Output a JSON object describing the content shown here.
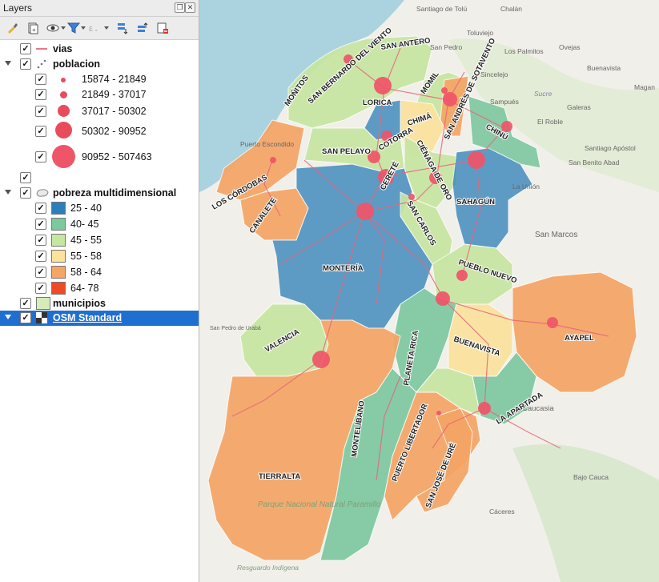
{
  "panel": {
    "title": "Layers"
  },
  "layers": {
    "vias": "vias",
    "poblacion": {
      "name": "poblacion",
      "classes": [
        "15874 - 21849",
        "21849 - 37017",
        "37017 - 50302",
        "50302 - 90952",
        "90952 - 507463"
      ]
    },
    "blank": "",
    "pobreza": {
      "name": "pobreza multidimensional",
      "classes": [
        "25 - 40",
        "40- 45",
        "45 - 55",
        "55 - 58",
        "58 - 64",
        "64- 78"
      ],
      "colors": [
        "#2c7fb8",
        "#7ec8a0",
        "#c7e6a2",
        "#fbe39c",
        "#f5a565",
        "#ef4a26"
      ]
    },
    "municipios": "municipios",
    "osm": "OSM Standard"
  },
  "map": {
    "places": {
      "santiago_tolu": "Santiago de\nTolú",
      "chalan": "Chalán",
      "toluviejo": "Toluviejo",
      "los_palmitos": "Los Palmitos",
      "san_pedro": "San Pedro",
      "ovejas": "Ovejas",
      "buenavista_top": "Buenavista",
      "magangue": "Magan",
      "sincelejo": "Sincelejo",
      "sucre": "Sucre",
      "sampues": "Sampués",
      "galeras": "Galeras",
      "el_roble": "El Roble",
      "puerto_escondido": "Puerto Escondido",
      "moñitos_pt": "Moñitos",
      "san_bernardo_pt": "San Bernardo",
      "santiago_apostol": "Santiago Apóstol",
      "san_benito": "San Benito\nAbad",
      "la_union": "La Unión",
      "san_marcos": "San Marcos",
      "monteria_pt": "Montería",
      "san_pedro_uraba": "San Pedro\nde Urabá",
      "planeta_rica_pt": "Planeta Rica",
      "caucasia": "Caucasia",
      "bajo_cauca": "Bajo Cauca",
      "caceres": "Cáceres",
      "parque": "Parque\nNacional\nNatural\nParamillo",
      "resguardo": "Resguardo\nIndígena"
    },
    "municipios": {
      "monitos": "MOÑITOS",
      "san_bernardo": "SAN BERNARDO DEL VIENTO",
      "san_antero": "SAN ANTERO",
      "momil": "MOMIL",
      "san_andres": "SAN ANDRÉS DE SOTAVENTO",
      "lorica": "LORICA",
      "cotorra": "COTORRA",
      "chima": "CHIMÁ",
      "chinu": "CHINÚ",
      "san_pelayo": "SAN PELAYO",
      "cienaga": "CIÉNAGA DE ORO",
      "cerete": "CERETÉ",
      "los_cordobas": "LOS CÓRDOBAS",
      "canalete": "CANALETE",
      "sahagun": "SAHAGÚN",
      "san_carlos": "SAN CARLOS",
      "monteria": "MONTERÍA",
      "pueblo_nuevo": "PUEBLO NUEVO",
      "valencia": "VALENCIA",
      "planeta_rica": "PLANETA RICA",
      "buenavista": "BUENAVISTA",
      "ayapel": "AYAPEL",
      "la_apartada": "LA APARTADA",
      "montelibano": "MONTELÍBANO",
      "puerto_libertador": "PUERTO LIBERTADOR",
      "tierralta": "TIERRALTA",
      "san_jose_ure": "SAN JOSÉ DE URÉ"
    }
  }
}
